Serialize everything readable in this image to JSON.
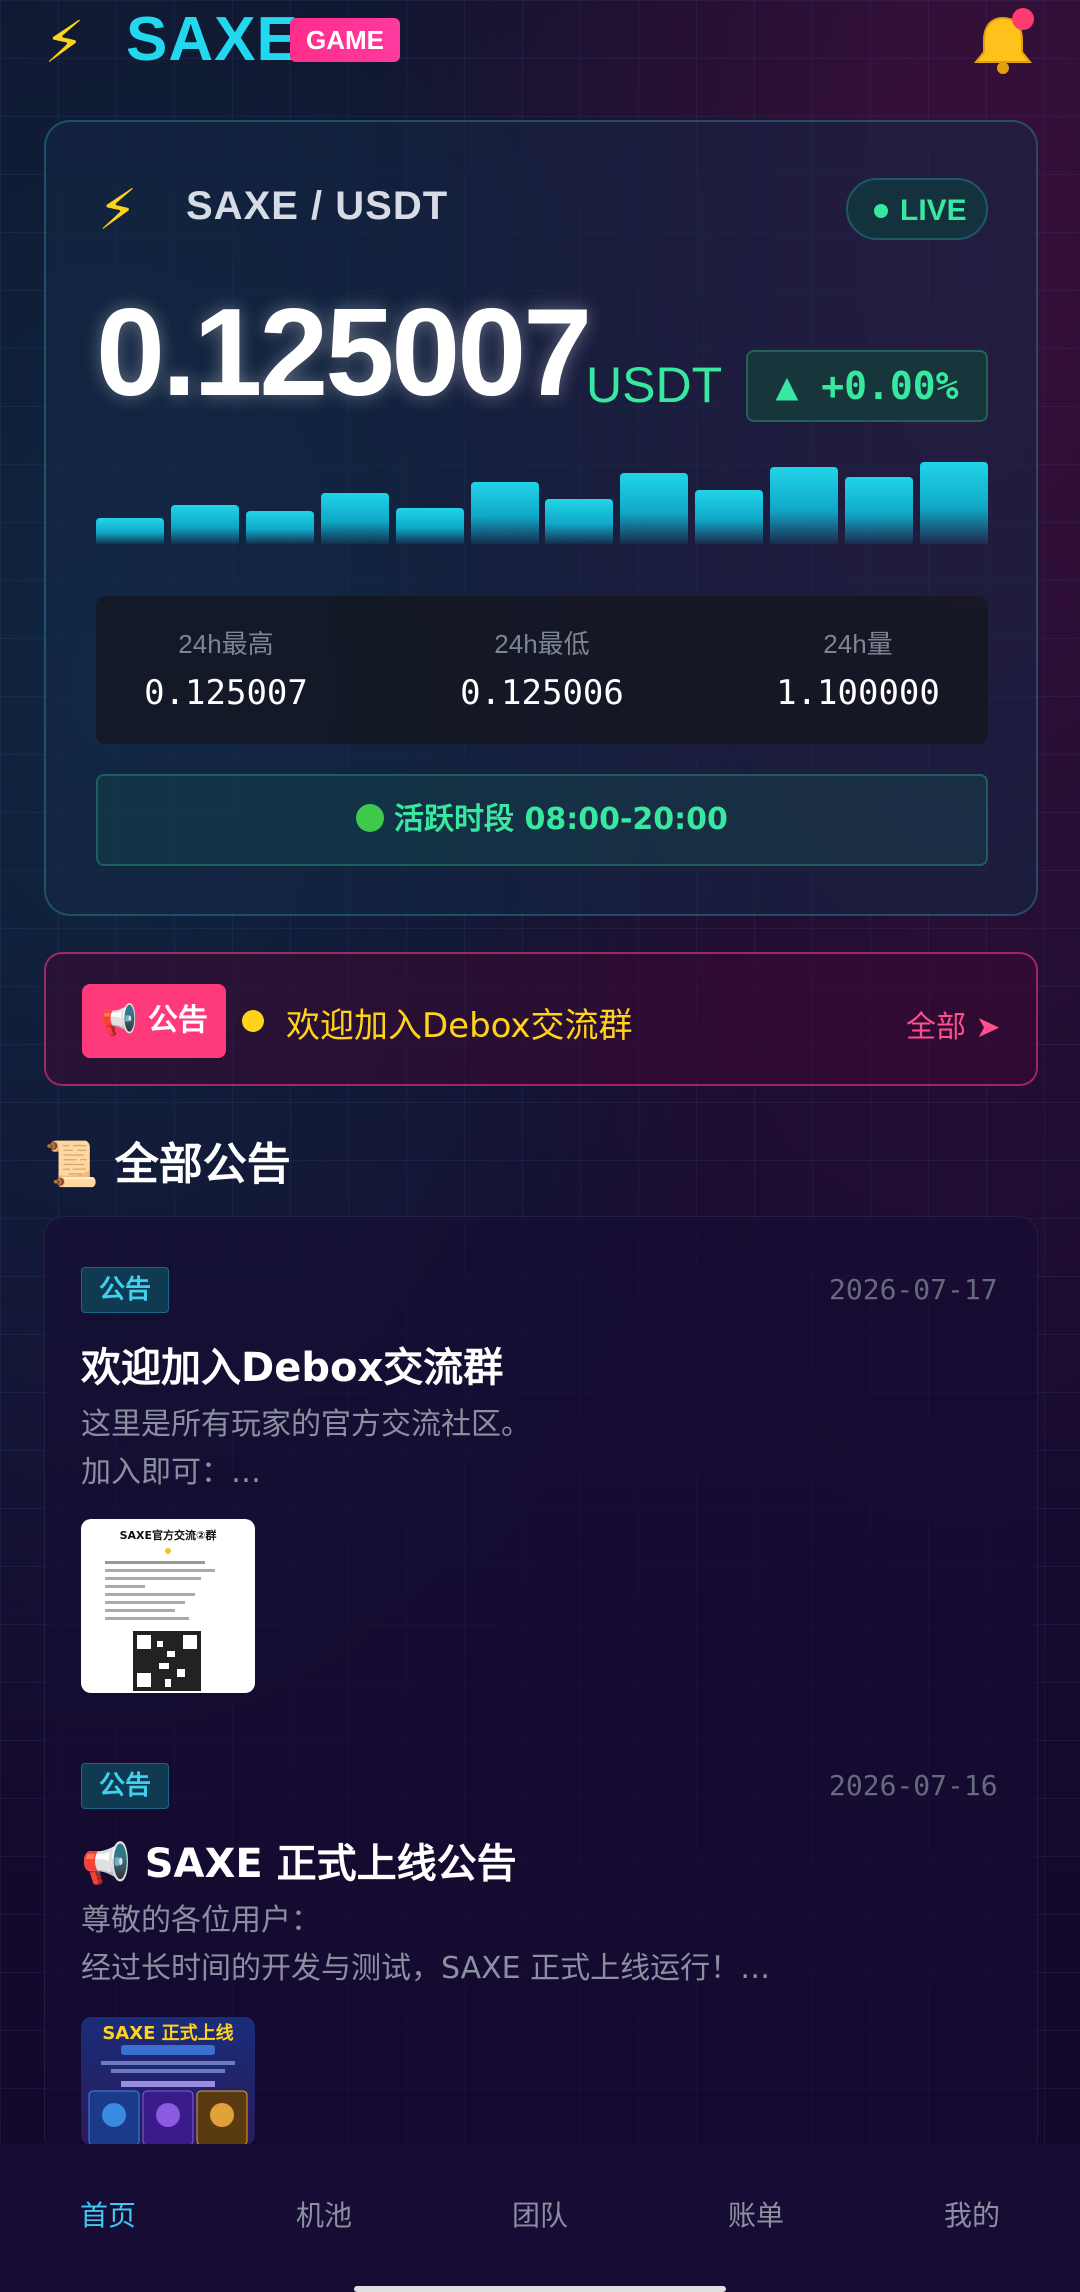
{
  "header": {
    "brand": "SAXE",
    "brand_icon": "lightning-bolt-icon",
    "game_badge": "GAME",
    "bell_icon": "bell-icon"
  },
  "market": {
    "pair": "SAXE / USDT",
    "live_label": "LIVE",
    "price": "0.125007",
    "price_unit": "USDT",
    "change": "▲ +0.00%",
    "bars": [
      0.32,
      0.48,
      0.4,
      0.62,
      0.44,
      0.76,
      0.55,
      0.86,
      0.66,
      0.94,
      0.82,
      1.0
    ],
    "stats": [
      {
        "label": "24h最高",
        "value": "0.125007"
      },
      {
        "label": "24h最低",
        "value": "0.125006"
      },
      {
        "label": "24h量",
        "value": "1.100000"
      }
    ],
    "active_hours": "活跃时段 08:00-20:00"
  },
  "ticker": {
    "tag": "📢 公告",
    "text": "欢迎加入Debox交流群",
    "all_label": "全部 ➤"
  },
  "section": {
    "icon": "📜",
    "title": "全部公告"
  },
  "announcements": [
    {
      "tag": "公告",
      "date": "2026-07-17",
      "title": "欢迎加入Debox交流群",
      "body_line1": "这里是所有玩家的官方交流社区。",
      "body_line2": "加入即可：…",
      "thumb_title": "SAXE官方交流②群"
    },
    {
      "tag": "公告",
      "date": "2026-07-16",
      "title": "📢 SAXE 正式上线公告",
      "body_line1": "尊敬的各位用户：",
      "body_line2": "经过长时间的开发与测试，SAXE 正式上线运行！…",
      "thumb_title": "SAXE 正式上线"
    }
  ],
  "nav": {
    "items": [
      "首页",
      "机池",
      "团队",
      "账单",
      "我的"
    ],
    "active_index": 0
  },
  "colors": {
    "accent_cyan": "#22d8ee",
    "accent_green": "#39e8a0",
    "accent_pink": "#ff3a7a",
    "accent_yellow": "#ffd21c"
  }
}
